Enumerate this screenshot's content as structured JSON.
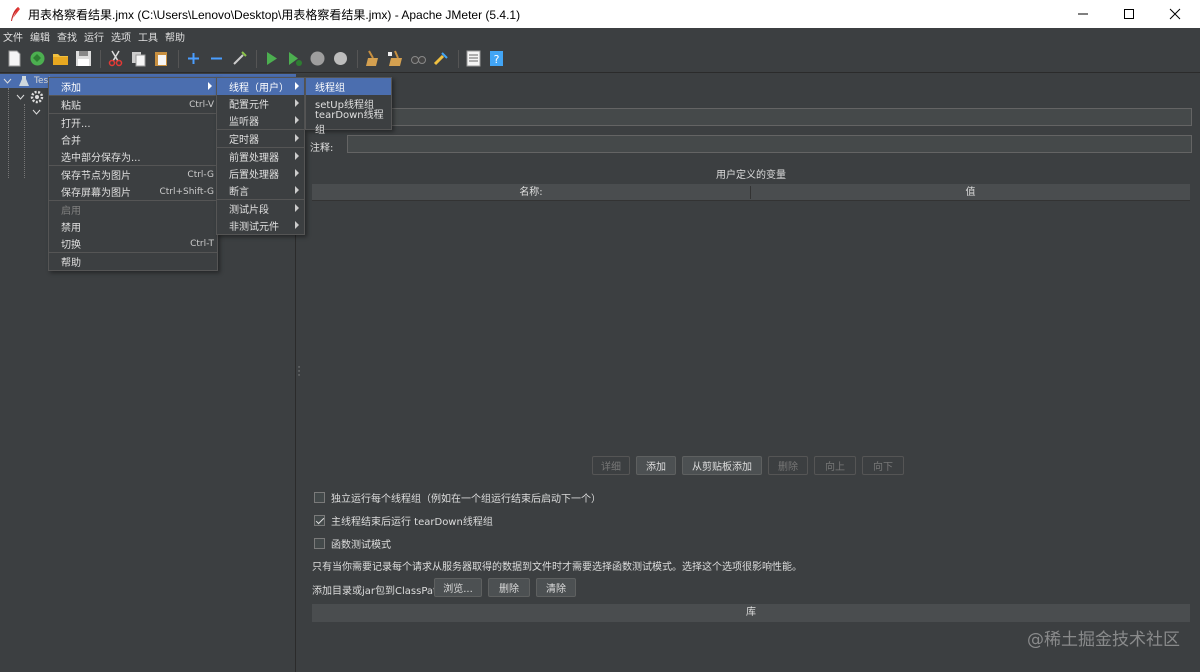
{
  "window": {
    "title": "用表格察看结果.jmx (C:\\Users\\Lenovo\\Desktop\\用表格察看结果.jmx) - Apache JMeter (5.4.1)"
  },
  "menubar": [
    "文件",
    "编辑",
    "查找",
    "运行",
    "选项",
    "工具",
    "帮助"
  ],
  "tree": {
    "root_label": "Test"
  },
  "context_menu": {
    "items": [
      {
        "label": "添加",
        "accel": "",
        "submenu": true
      },
      {
        "label": "粘贴",
        "accel": "Ctrl-V"
      },
      {
        "label": "打开...",
        "accel": ""
      },
      {
        "label": "合并",
        "accel": ""
      },
      {
        "label": "选中部分保存为...",
        "accel": ""
      },
      {
        "label": "保存节点为图片",
        "accel": "Ctrl-G"
      },
      {
        "label": "保存屏幕为图片",
        "accel": "Ctrl+Shift-G"
      },
      {
        "label": "启用",
        "accel": ""
      },
      {
        "label": "禁用",
        "accel": ""
      },
      {
        "label": "切换",
        "accel": "Ctrl-T"
      },
      {
        "label": "帮助",
        "accel": ""
      }
    ]
  },
  "add_submenu": {
    "items": [
      "线程（用户）",
      "配置元件",
      "监听器",
      "定时器",
      "前置处理器",
      "后置处理器",
      "断言",
      "测试片段",
      "非测试元件"
    ]
  },
  "thread_submenu": {
    "items": [
      "线程组",
      "setUp线程组",
      "tearDown线程组"
    ]
  },
  "right_panel": {
    "comment_label": "注释:",
    "table_caption": "用户定义的变量",
    "col_name": "名称:",
    "col_value": "值",
    "buttons": {
      "detail": "详细",
      "add": "添加",
      "add_clipboard": "从剪贴板添加",
      "delete": "删除",
      "up": "向上",
      "down": "向下"
    },
    "checkboxes": [
      {
        "label": "独立运行每个线程组（例如在一个组运行结束后启动下一个）",
        "checked": false
      },
      {
        "label": "主线程结束后运行 tearDown线程组",
        "checked": true
      },
      {
        "label": "函数测试模式",
        "checked": false
      }
    ],
    "info_text": "只有当你需要记录每个请求从服务器取得的数据到文件时才需要选择函数测试模式。选择这个选项很影响性能。",
    "classpath_label": "添加目录或jar包到ClassPath",
    "classpath_buttons": {
      "browse": "浏览...",
      "delete": "删除",
      "clear": "清除"
    },
    "lib_header": "库"
  },
  "watermark": "@稀土掘金技术社区",
  "colors": {
    "background": "#3c3f41",
    "selection": "#4b6eaf",
    "titlebar": "#ffffff"
  }
}
